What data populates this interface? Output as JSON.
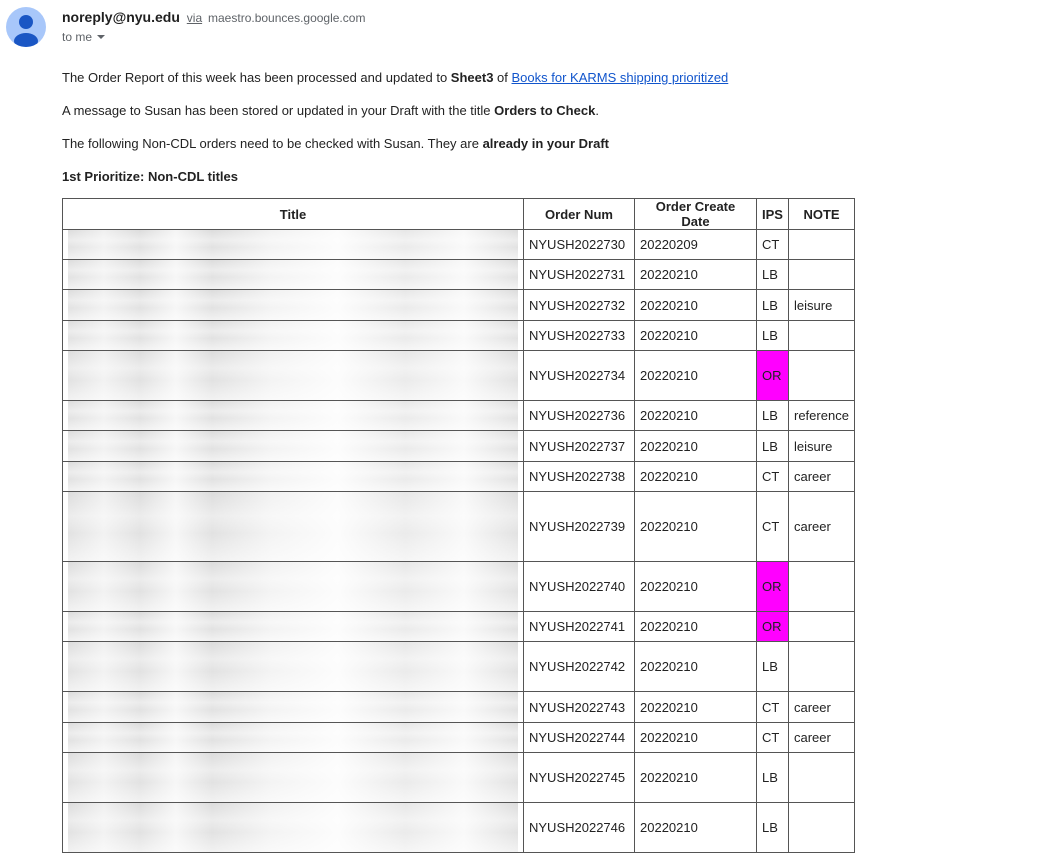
{
  "email": {
    "sender_name": "noreply@nyu.edu",
    "via_label": "via",
    "via_domain": "maestro.bounces.google.com",
    "recipient": "to me"
  },
  "body": {
    "p1_prefix": "The Order Report of this week has been processed and updated to ",
    "p1_sheet": "Sheet3",
    "p1_of": " of ",
    "p1_link": "Books for KARMS shipping prioritized",
    "p2_prefix": "A message to Susan has been stored or updated in your Draft with the title ",
    "p2_title": "Orders to Check",
    "p2_suffix": ".",
    "p3_prefix": "The following Non-CDL orders need to be checked with Susan. They are ",
    "p3_bold": "already in your Draft",
    "section_heading": "1st Prioritize: Non-CDL titles"
  },
  "table": {
    "headers": {
      "title": "Title",
      "order_num": "Order Num",
      "order_date": "Order Create Date",
      "ips": "IPS",
      "note": "NOTE"
    },
    "rows": [
      {
        "order_num": "NYUSH2022730",
        "date": "20220209",
        "ips": "CT",
        "note": ""
      },
      {
        "order_num": "NYUSH2022731",
        "date": "20220210",
        "ips": "LB",
        "note": ""
      },
      {
        "order_num": "NYUSH2022732",
        "date": "20220210",
        "ips": "LB",
        "note": "leisure"
      },
      {
        "order_num": "NYUSH2022733",
        "date": "20220210",
        "ips": "LB",
        "note": ""
      },
      {
        "order_num": "NYUSH2022734",
        "date": "20220210",
        "ips": "OR",
        "note": ""
      },
      {
        "order_num": "NYUSH2022736",
        "date": "20220210",
        "ips": "LB",
        "note": "reference"
      },
      {
        "order_num": "NYUSH2022737",
        "date": "20220210",
        "ips": "LB",
        "note": "leisure"
      },
      {
        "order_num": "NYUSH2022738",
        "date": "20220210",
        "ips": "CT",
        "note": "career"
      },
      {
        "order_num": "NYUSH2022739",
        "date": "20220210",
        "ips": "CT",
        "note": "career"
      },
      {
        "order_num": "NYUSH2022740",
        "date": "20220210",
        "ips": "OR",
        "note": ""
      },
      {
        "order_num": "NYUSH2022741",
        "date": "20220210",
        "ips": "OR",
        "note": ""
      },
      {
        "order_num": "NYUSH2022742",
        "date": "20220210",
        "ips": "LB",
        "note": ""
      },
      {
        "order_num": "NYUSH2022743",
        "date": "20220210",
        "ips": "CT",
        "note": "career"
      },
      {
        "order_num": "NYUSH2022744",
        "date": "20220210",
        "ips": "CT",
        "note": "career"
      },
      {
        "order_num": "NYUSH2022745",
        "date": "20220210",
        "ips": "LB",
        "note": ""
      },
      {
        "order_num": "NYUSH2022746",
        "date": "20220210",
        "ips": "LB",
        "note": ""
      }
    ]
  },
  "colors": {
    "or_highlight": "#ff00ff",
    "link": "#1155cc",
    "avatar": "#a8c7fa"
  }
}
